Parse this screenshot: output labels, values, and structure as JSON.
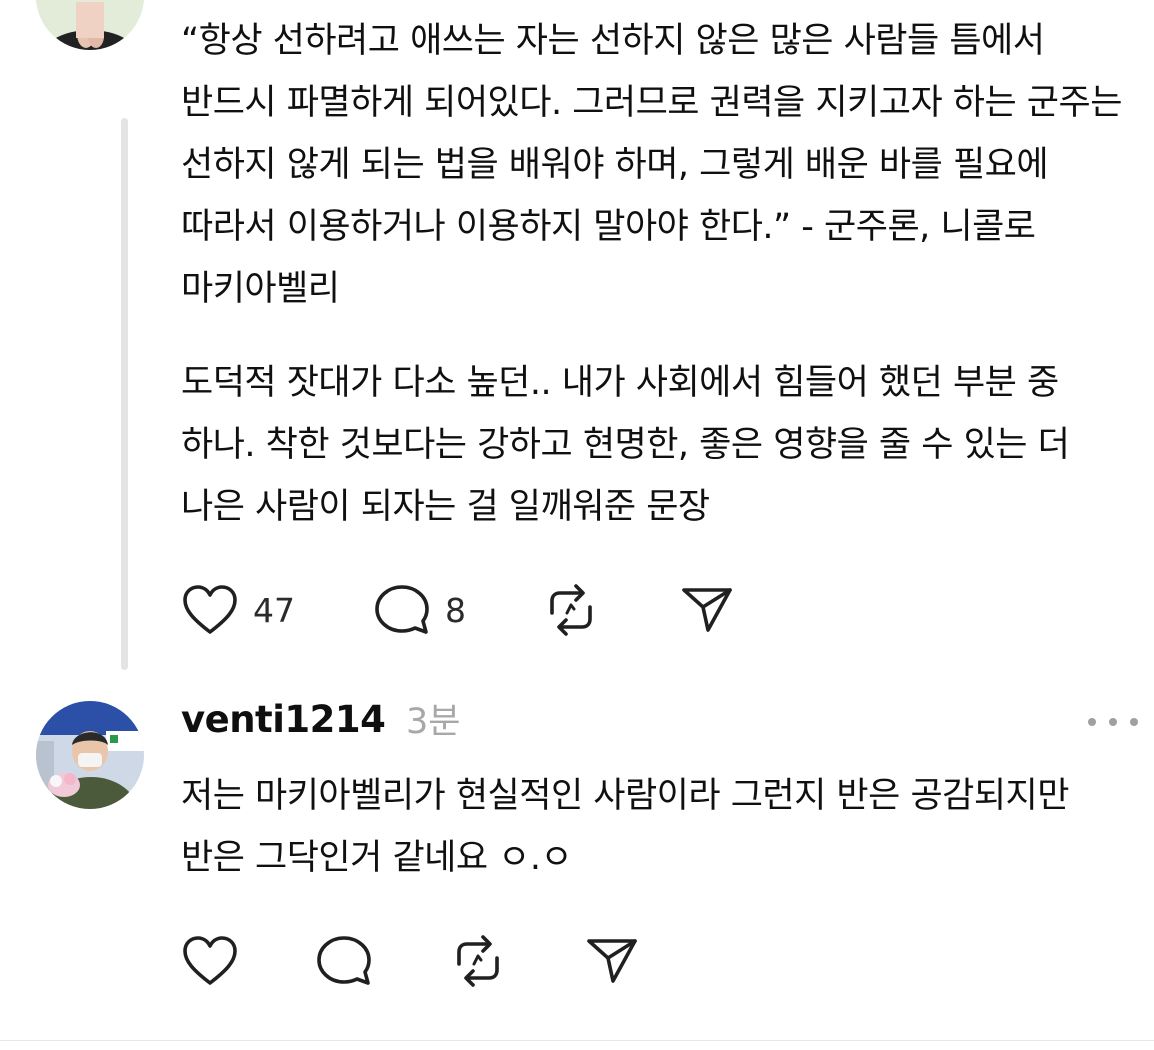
{
  "post": {
    "text": "“항상 선하려고 애쓰는 자는 선하지 않은 많은 사람들 틈에서 반드시 파멸하게 되어있다. 그러므로 권력을 지키고자 하는 군주는 선하지 않게 되는 법을 배워야 하며, 그렇게 배운 바를 필요에 따라서 이용하거나 이용하지 말아야 한다.” - 군주론, 니콜로 마키아벨리",
    "text2": "도덕적 잣대가 다소 높던.. 내가 사회에서 힘들어 했던 부분 중 하나. 착한 것보다는 강하고 현명한, 좋은 영향을 줄 수 있는 더 나은 사람이 되자는 걸 일깨워준 문장",
    "actions": {
      "like_count": "47",
      "reply_count": "8"
    }
  },
  "reply": {
    "username": "venti1214",
    "timestamp": "3분",
    "text": "저는 마키아벨리가 현실적인 사람이라 그런지 반은 공감되지만 반은 그닥인거 같네요 ㅇ.ㅇ"
  },
  "icons": {
    "like": "heart-icon",
    "reply": "speech-bubble-icon",
    "repost": "repost-icon",
    "share": "send-icon",
    "more": "more-dots-icon"
  },
  "colors": {
    "text": "#101010",
    "muted": "#a8a8a8",
    "thread_line": "#e4e4e4"
  }
}
